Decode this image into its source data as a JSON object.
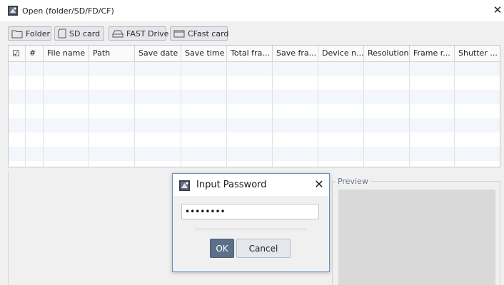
{
  "window": {
    "title": "Open (folder/SD/FD/CF)",
    "close_glyph": "✕"
  },
  "toolbar": {
    "buttons": [
      {
        "label": "Folder",
        "icon": "folder-icon"
      },
      {
        "label": "SD card",
        "icon": "sd-card-icon"
      },
      {
        "label": "FAST Drive",
        "icon": "fast-drive-icon"
      },
      {
        "label": "CFast card",
        "icon": "cfast-card-icon"
      }
    ]
  },
  "table": {
    "check_header": "☑",
    "columns": [
      "#",
      "File name",
      "Path",
      "Save date",
      "Save time",
      "Total fra...",
      "Save fra...",
      "Device n...",
      "Resolution",
      "Frame r...",
      "Shutter ..."
    ]
  },
  "preview": {
    "label": "Preview"
  },
  "password_dialog": {
    "title": "Input Password",
    "close_glyph": "✕",
    "password_value": "••••••••",
    "ok_label": "OK",
    "cancel_label": "Cancel"
  },
  "colors": {
    "accent": "#5b7189",
    "dialog_border": "#6b8fbf",
    "preview_label": "#6b7790"
  }
}
